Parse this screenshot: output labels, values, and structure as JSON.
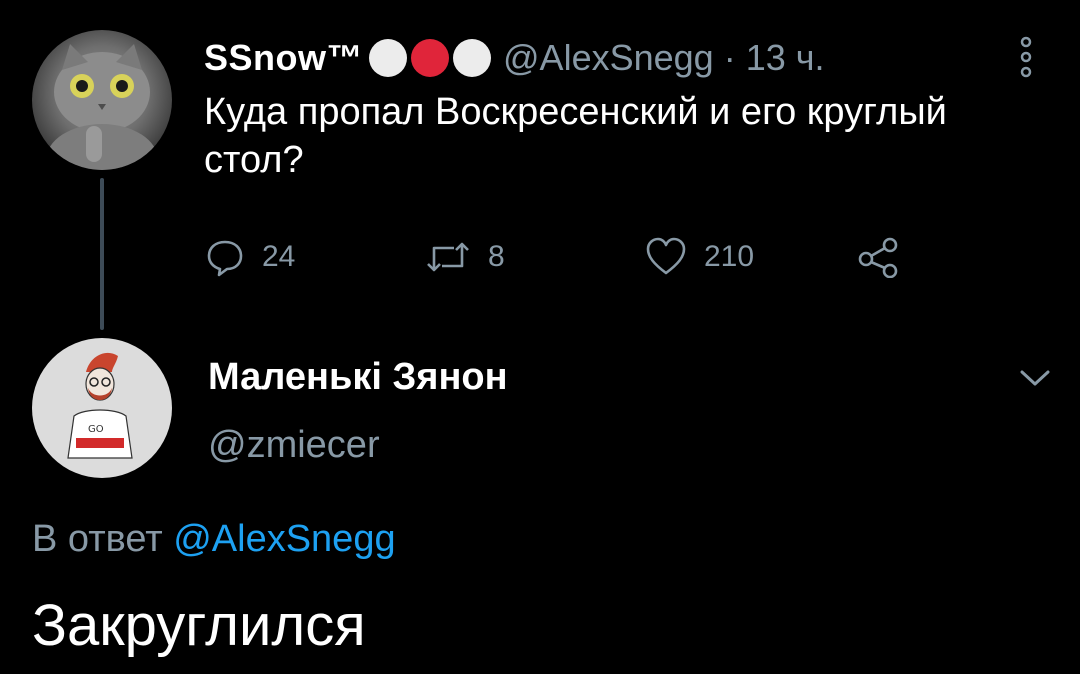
{
  "tweet": {
    "display_name": "SSnow™",
    "badge_colors": [
      "#ececec",
      "#e0253a",
      "#ececec"
    ],
    "handle": "@AlexSnegg",
    "time": "· 13 ч.",
    "text": "Куда пропал Воскресенский и его круглый стол?",
    "actions": {
      "replies": "24",
      "retweets": "8",
      "likes": "210"
    }
  },
  "reply": {
    "display_name": "Маленькі Зянон",
    "handle": "@zmiecer",
    "in_reply_to_prefix": "В ответ ",
    "in_reply_to_handle": "@AlexSnegg",
    "text": "Закруглился"
  },
  "colors": {
    "background": "#000000",
    "text_primary": "#ffffff",
    "text_secondary": "#8899a6",
    "link": "#1da1f2",
    "thread_line": "#3d4b57"
  },
  "icons": {
    "more": "more-vertical-icon",
    "reply": "reply-bubble-icon",
    "retweet": "retweet-icon",
    "like": "heart-icon",
    "share": "share-icon",
    "expand": "chevron-down-icon"
  }
}
